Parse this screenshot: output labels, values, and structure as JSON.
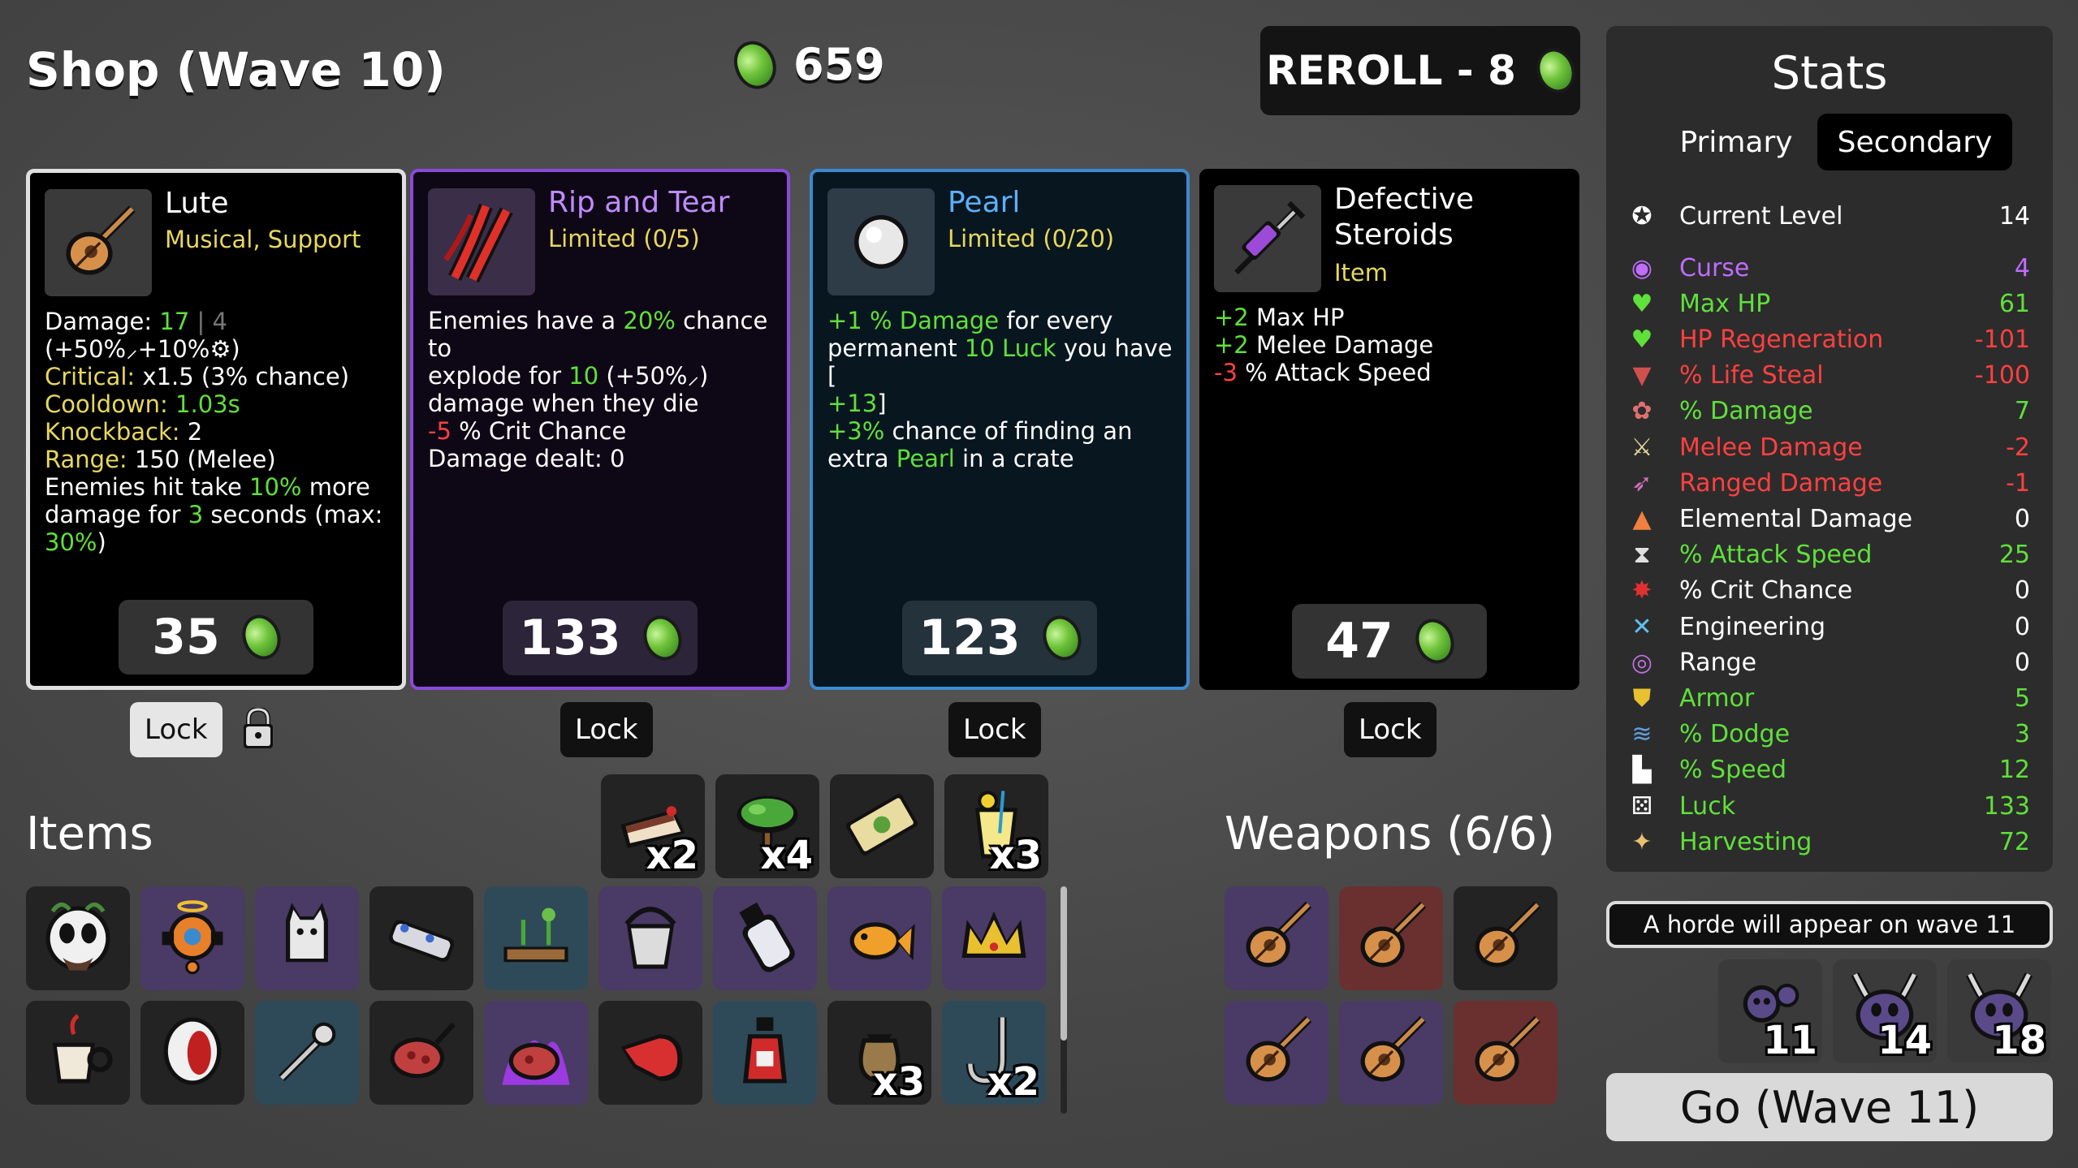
{
  "header": {
    "shop_title": "Shop (Wave 10)",
    "materials": "659",
    "reroll_label": "REROLL - 8"
  },
  "cards": [
    {
      "name": "Lute",
      "sub": "Musical, Support",
      "icon": "lute-icon",
      "desc_lines": [
        {
          "parts": [
            [
              "Damage: ",
              ""
            ],
            [
              "17",
              "g"
            ],
            [
              " | 4 ",
              "gr"
            ],
            [
              "(+50%⸝+10%⚙)",
              ""
            ]
          ]
        },
        {
          "parts": [
            [
              "Critical: ",
              "y"
            ],
            [
              "x1.5 (3% chance)",
              ""
            ]
          ]
        },
        {
          "parts": [
            [
              "Cooldown: ",
              "y"
            ],
            [
              "1.03s",
              "g"
            ]
          ]
        },
        {
          "parts": [
            [
              "Knockback: ",
              "y"
            ],
            [
              "2",
              ""
            ]
          ]
        },
        {
          "parts": [
            [
              "Range: ",
              "y"
            ],
            [
              "150 (Melee)",
              ""
            ]
          ]
        },
        {
          "parts": [
            [
              "Enemies hit take ",
              ""
            ],
            [
              "10%",
              "g"
            ],
            [
              " more",
              ""
            ]
          ]
        },
        {
          "parts": [
            [
              "damage for ",
              ""
            ],
            [
              "3",
              "g"
            ],
            [
              " seconds (max:",
              ""
            ]
          ]
        },
        {
          "parts": [
            [
              "30%",
              "g"
            ],
            [
              ")",
              ""
            ]
          ]
        }
      ],
      "price": "35",
      "lock_label": "Lock",
      "locked": true
    },
    {
      "name": "Rip and Tear",
      "sub": "Limited (0/5)",
      "icon": "claw-marks-icon",
      "desc_lines": [
        {
          "parts": [
            [
              "Enemies have a ",
              ""
            ],
            [
              "20%",
              "g"
            ],
            [
              " chance to",
              ""
            ]
          ]
        },
        {
          "parts": [
            [
              "explode for ",
              ""
            ],
            [
              "10",
              "g"
            ],
            [
              " (+50%⸝)",
              ""
            ]
          ]
        },
        {
          "parts": [
            [
              "damage when they die",
              ""
            ]
          ]
        },
        {
          "parts": [
            [
              "-5",
              "r"
            ],
            [
              " % Crit Chance",
              ""
            ]
          ]
        },
        {
          "parts": [
            [
              "Damage dealt: 0",
              ""
            ]
          ]
        }
      ],
      "price": "133",
      "lock_label": "Lock",
      "locked": false
    },
    {
      "name": "Pearl",
      "sub": "Limited (0/20)",
      "icon": "pearl-icon",
      "desc_lines": [
        {
          "parts": [
            [
              "+1",
              "g"
            ],
            [
              " % Damage",
              "g"
            ],
            [
              " for every",
              ""
            ]
          ]
        },
        {
          "parts": [
            [
              "permanent ",
              ""
            ],
            [
              "10 Luck",
              "g"
            ],
            [
              " you have [",
              ""
            ]
          ]
        },
        {
          "parts": [
            [
              "+13",
              "g"
            ],
            [
              "]",
              ""
            ]
          ]
        },
        {
          "parts": [
            [
              "+3%",
              "g"
            ],
            [
              " chance of finding an",
              ""
            ]
          ]
        },
        {
          "parts": [
            [
              "extra ",
              ""
            ],
            [
              "Pearl",
              "g"
            ],
            [
              " in a crate",
              ""
            ]
          ]
        }
      ],
      "price": "123",
      "lock_label": "Lock",
      "locked": false
    },
    {
      "name": "Defective Steroids",
      "sub": "Item",
      "icon": "syringe-icon",
      "desc_lines": [
        {
          "parts": [
            [
              "+2",
              "g"
            ],
            [
              " Max HP",
              ""
            ]
          ]
        },
        {
          "parts": [
            [
              "+2",
              "g"
            ],
            [
              " Melee Damage",
              ""
            ]
          ]
        },
        {
          "parts": [
            [
              "-3",
              "r"
            ],
            [
              " % Attack Speed",
              ""
            ]
          ]
        }
      ],
      "price": "47",
      "lock_label": "Lock",
      "locked": false
    }
  ],
  "items_title": "Items",
  "weapons_title": "Weapons (6/6)",
  "items_top": [
    {
      "icon": "cake-icon",
      "count": "x2"
    },
    {
      "icon": "tree-icon",
      "count": "x4"
    },
    {
      "icon": "banknote-icon",
      "count": ""
    },
    {
      "icon": "lemonade-icon",
      "count": "x3"
    }
  ],
  "items_rows": [
    [
      {
        "icon": "panda-mask-icon",
        "tier": 0
      },
      {
        "icon": "angel-drone-icon",
        "tier": 2
      },
      {
        "icon": "cat-statue-icon",
        "tier": 2
      },
      {
        "icon": "robot-arm-icon",
        "tier": 0
      },
      {
        "icon": "garden-bed-icon",
        "tier": 1
      },
      {
        "icon": "bucket-icon",
        "tier": 2
      },
      {
        "icon": "bottle-icon",
        "tier": 2
      },
      {
        "icon": "goldfish-icon",
        "tier": 2
      },
      {
        "icon": "crown-icon",
        "tier": 2
      }
    ],
    [
      {
        "icon": "coffee-cup-icon",
        "tier": 0
      },
      {
        "icon": "mouth-icon",
        "tier": 0
      },
      {
        "icon": "spoon-icon",
        "tier": 1
      },
      {
        "icon": "meat-icon",
        "tier": 0
      },
      {
        "icon": "cursed-meat-icon",
        "tier": 2
      },
      {
        "icon": "whistle-icon",
        "tier": 0
      },
      {
        "icon": "potion-icon",
        "tier": 1
      },
      {
        "icon": "loot-bag-icon",
        "tier": 0,
        "count": "x3"
      },
      {
        "icon": "hook-icon",
        "tier": 1,
        "count": "x2"
      }
    ]
  ],
  "weapons": [
    {
      "icon": "lute-icon",
      "tier": 2
    },
    {
      "icon": "lute-icon",
      "tier": 3
    },
    {
      "icon": "lute-icon",
      "tier": 0
    },
    {
      "icon": "lute-icon",
      "tier": 2
    },
    {
      "icon": "lute-icon",
      "tier": 2
    },
    {
      "icon": "lute-icon",
      "tier": 3
    }
  ],
  "stats": {
    "title": "Stats",
    "tab_primary": "Primary",
    "tab_secondary": "Secondary",
    "rows": [
      {
        "icon": "level-icon",
        "label": "Current Level",
        "value": "14",
        "color": "#ffffff"
      },
      {
        "icon": "curse-eye-icon",
        "label": "Curse",
        "value": "4",
        "color": "#bf6cff"
      },
      {
        "icon": "heart-icon",
        "label": "Max HP",
        "value": "61",
        "color": "#5fe03a"
      },
      {
        "icon": "heart-plus-icon",
        "label": "HP Regeneration",
        "value": "-101",
        "color": "#ff4040"
      },
      {
        "icon": "fang-icon",
        "label": "% Life Steal",
        "value": "-100",
        "color": "#ff4040"
      },
      {
        "icon": "brain-icon",
        "label": "% Damage",
        "value": "7",
        "color": "#5fe03a"
      },
      {
        "icon": "sword-icon",
        "label": "Melee Damage",
        "value": "-2",
        "color": "#ff4040"
      },
      {
        "icon": "bow-icon",
        "label": "Ranged Damage",
        "value": "-1",
        "color": "#ff4040"
      },
      {
        "icon": "flame-icon",
        "label": "Elemental Damage",
        "value": "0",
        "color": "#ffffff"
      },
      {
        "icon": "hourglass-icon",
        "label": "% Attack Speed",
        "value": "25",
        "color": "#5fe03a"
      },
      {
        "icon": "crit-star-icon",
        "label": "% Crit Chance",
        "value": "0",
        "color": "#ffffff"
      },
      {
        "icon": "wrench-icon",
        "label": "Engineering",
        "value": "0",
        "color": "#ffffff"
      },
      {
        "icon": "range-icon",
        "label": "Range",
        "value": "0",
        "color": "#ffffff"
      },
      {
        "icon": "shield-icon",
        "label": "Armor",
        "value": "5",
        "color": "#5fe03a"
      },
      {
        "icon": "dodge-icon",
        "label": "% Dodge",
        "value": "3",
        "color": "#5fe03a"
      },
      {
        "icon": "boot-icon",
        "label": "% Speed",
        "value": "12",
        "color": "#5fe03a"
      },
      {
        "icon": "dice-icon",
        "label": "Luck",
        "value": "133",
        "color": "#5fe03a"
      },
      {
        "icon": "harvest-icon",
        "label": "Harvesting",
        "value": "72",
        "color": "#5fe03a"
      }
    ]
  },
  "horde_text": "A horde will appear on wave 11",
  "enemies": [
    {
      "icon": "bug-swarm-icon",
      "count": "11"
    },
    {
      "icon": "horned-alien-icon",
      "count": "14"
    },
    {
      "icon": "horned-alien-icon",
      "count": "18"
    }
  ],
  "go_label": "Go (Wave 11)"
}
